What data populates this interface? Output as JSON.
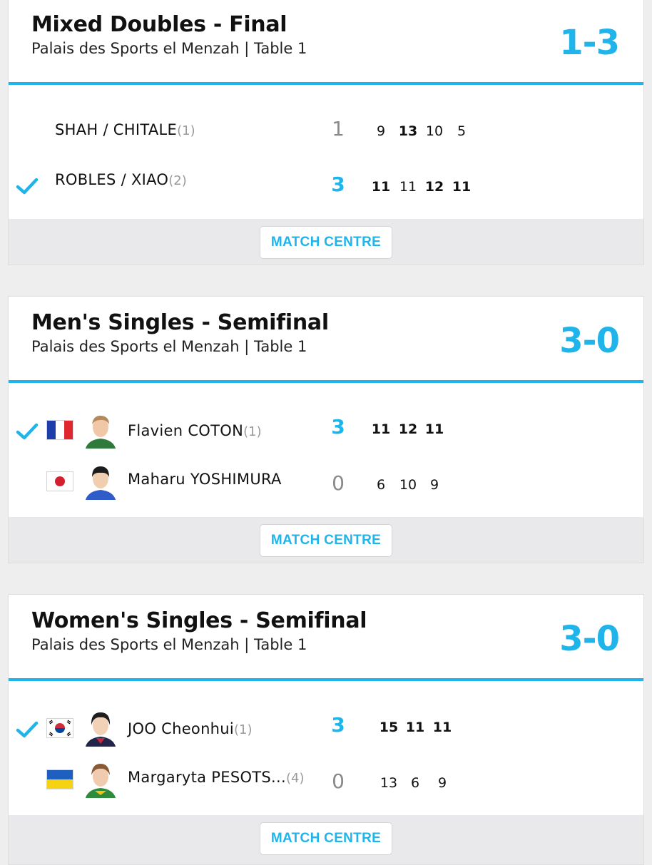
{
  "colors": {
    "accent": "#1fb4ea",
    "background": "#eeeeef",
    "footer": "#e9e9eb"
  },
  "matches": [
    {
      "title": "Mixed Doubles - Final",
      "venue": "Palais des Sports el Menzah | Table 1",
      "score": "1-3",
      "button": "MATCH CENTRE",
      "players": [
        {
          "name": "SHAH / CHITALE",
          "seed": "(1)",
          "winner": false,
          "games": "1",
          "sets": [
            "9",
            "13",
            "10",
            "5"
          ]
        },
        {
          "name": "ROBLES / XIAO",
          "seed": "(2)",
          "winner": true,
          "games": "3",
          "sets": [
            "11",
            "11",
            "12",
            "11"
          ]
        }
      ]
    },
    {
      "title": "Men's Singles - Semifinal",
      "venue": "Palais des Sports el Menzah | Table 1",
      "score": "3-0",
      "button": "MATCH CENTRE",
      "players": [
        {
          "name": "Flavien COTON",
          "seed": "(1)",
          "flag": "france-flag",
          "winner": true,
          "games": "3",
          "sets": [
            "11",
            "12",
            "11"
          ]
        },
        {
          "name": "Maharu YOSHIMURA",
          "seed": "",
          "flag": "japan-flag",
          "winner": false,
          "games": "0",
          "sets": [
            "6",
            "10",
            "9"
          ]
        }
      ]
    },
    {
      "title": "Women's Singles - Semifinal",
      "venue": "Palais des Sports el Menzah | Table 1",
      "score": "3-0",
      "button": "MATCH CENTRE",
      "players": [
        {
          "name": "JOO Cheonhui",
          "seed": "(1)",
          "flag": "south-korea-flag",
          "winner": true,
          "games": "3",
          "sets": [
            "15",
            "11",
            "11"
          ]
        },
        {
          "name": "Margaryta PESOTS...",
          "seed": "(4)",
          "flag": "ukraine-flag",
          "winner": false,
          "games": "0",
          "sets": [
            "13",
            "6",
            "9"
          ]
        }
      ]
    }
  ]
}
